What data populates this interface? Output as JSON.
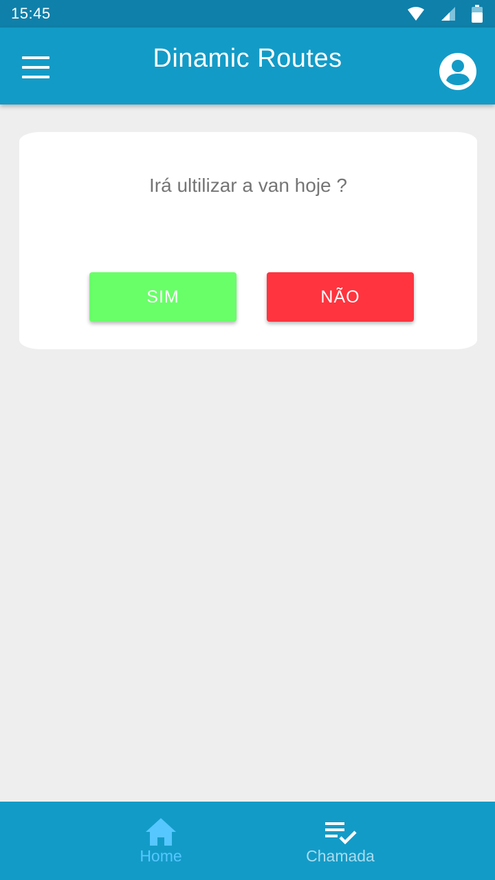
{
  "status_bar": {
    "time": "15:45",
    "icons": [
      "wifi-icon",
      "signal-icon",
      "battery-icon"
    ]
  },
  "app_bar": {
    "title": "Dinamic Routes",
    "menu_icon": "menu-icon",
    "account_icon": "account-icon"
  },
  "card": {
    "question": "Irá ultilizar a van hoje ?",
    "yes_label": "SIM",
    "no_label": "NÃO"
  },
  "bottom_nav": {
    "items": [
      {
        "label": "Home",
        "icon": "home-icon",
        "active": true
      },
      {
        "label": "Chamada",
        "icon": "checklist-icon",
        "active": false
      }
    ]
  },
  "colors": {
    "status_bar": "#0f80aa",
    "primary": "#139bc7",
    "background": "#eeeeee",
    "yes_button": "#69ff69",
    "no_button": "#ff343f",
    "active_nav": "#56c7ff",
    "inactive_nav": "#a8dcef"
  }
}
